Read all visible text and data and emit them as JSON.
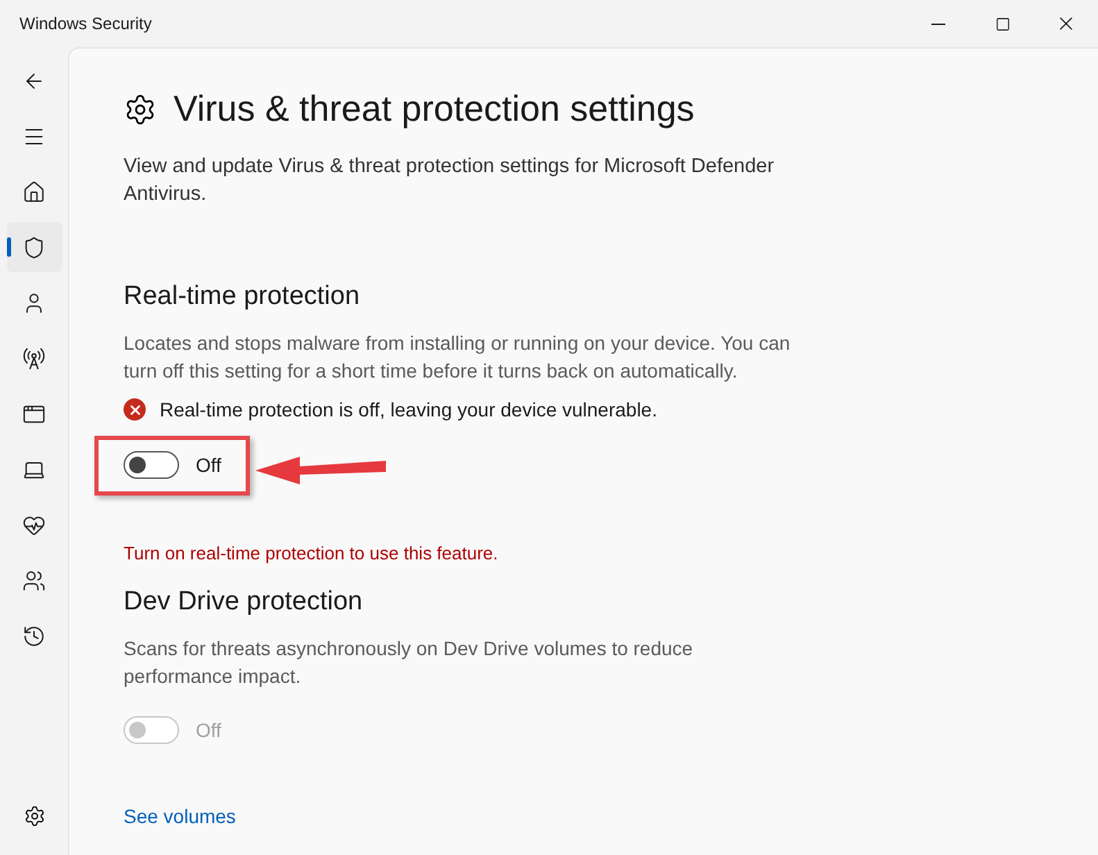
{
  "window": {
    "title": "Windows Security"
  },
  "nav": {
    "items": [
      {
        "selected": false
      },
      {
        "selected": false
      },
      {
        "selected": false
      },
      {
        "selected": true
      },
      {
        "selected": false
      },
      {
        "selected": false
      },
      {
        "selected": false
      },
      {
        "selected": false
      },
      {
        "selected": false
      },
      {
        "selected": false
      },
      {
        "selected": false
      }
    ]
  },
  "page": {
    "title": "Virus & threat protection settings",
    "description": "View and update Virus & threat protection settings for Microsoft Defender Antivirus."
  },
  "sections": [
    {
      "heading": "Real-time protection",
      "body": "Locates and stops malware from installing or running on your device. You can turn off this setting for a short time before it turns back on automatically.",
      "alert": "Real-time protection is off, leaving your device vulnerable.",
      "toggle": {
        "on": false,
        "disabled": false,
        "label": "Off",
        "highlighted": true
      }
    },
    {
      "notice": "Turn on real-time protection to use this feature.",
      "heading": "Dev Drive protection",
      "body": "Scans for threats asynchronously on Dev Drive volumes to reduce performance impact.",
      "toggle": {
        "on": false,
        "disabled": true,
        "label": "Off",
        "highlighted": false
      },
      "link": "See volumes"
    }
  ]
}
